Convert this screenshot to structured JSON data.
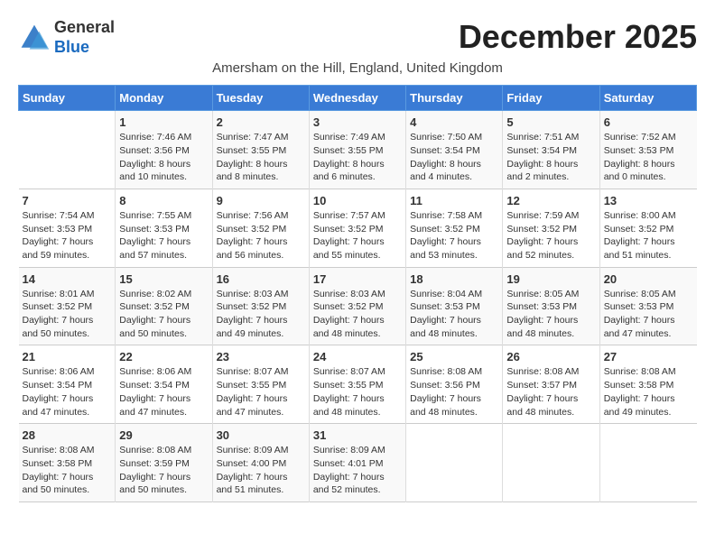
{
  "header": {
    "logo_line1": "General",
    "logo_line2": "Blue",
    "title": "December 2025",
    "subtitle": "Amersham on the Hill, England, United Kingdom"
  },
  "columns": [
    "Sunday",
    "Monday",
    "Tuesday",
    "Wednesday",
    "Thursday",
    "Friday",
    "Saturday"
  ],
  "weeks": [
    [
      {
        "num": "",
        "info": ""
      },
      {
        "num": "1",
        "info": "Sunrise: 7:46 AM\nSunset: 3:56 PM\nDaylight: 8 hours\nand 10 minutes."
      },
      {
        "num": "2",
        "info": "Sunrise: 7:47 AM\nSunset: 3:55 PM\nDaylight: 8 hours\nand 8 minutes."
      },
      {
        "num": "3",
        "info": "Sunrise: 7:49 AM\nSunset: 3:55 PM\nDaylight: 8 hours\nand 6 minutes."
      },
      {
        "num": "4",
        "info": "Sunrise: 7:50 AM\nSunset: 3:54 PM\nDaylight: 8 hours\nand 4 minutes."
      },
      {
        "num": "5",
        "info": "Sunrise: 7:51 AM\nSunset: 3:54 PM\nDaylight: 8 hours\nand 2 minutes."
      },
      {
        "num": "6",
        "info": "Sunrise: 7:52 AM\nSunset: 3:53 PM\nDaylight: 8 hours\nand 0 minutes."
      }
    ],
    [
      {
        "num": "7",
        "info": "Sunrise: 7:54 AM\nSunset: 3:53 PM\nDaylight: 7 hours\nand 59 minutes."
      },
      {
        "num": "8",
        "info": "Sunrise: 7:55 AM\nSunset: 3:53 PM\nDaylight: 7 hours\nand 57 minutes."
      },
      {
        "num": "9",
        "info": "Sunrise: 7:56 AM\nSunset: 3:52 PM\nDaylight: 7 hours\nand 56 minutes."
      },
      {
        "num": "10",
        "info": "Sunrise: 7:57 AM\nSunset: 3:52 PM\nDaylight: 7 hours\nand 55 minutes."
      },
      {
        "num": "11",
        "info": "Sunrise: 7:58 AM\nSunset: 3:52 PM\nDaylight: 7 hours\nand 53 minutes."
      },
      {
        "num": "12",
        "info": "Sunrise: 7:59 AM\nSunset: 3:52 PM\nDaylight: 7 hours\nand 52 minutes."
      },
      {
        "num": "13",
        "info": "Sunrise: 8:00 AM\nSunset: 3:52 PM\nDaylight: 7 hours\nand 51 minutes."
      }
    ],
    [
      {
        "num": "14",
        "info": "Sunrise: 8:01 AM\nSunset: 3:52 PM\nDaylight: 7 hours\nand 50 minutes."
      },
      {
        "num": "15",
        "info": "Sunrise: 8:02 AM\nSunset: 3:52 PM\nDaylight: 7 hours\nand 50 minutes."
      },
      {
        "num": "16",
        "info": "Sunrise: 8:03 AM\nSunset: 3:52 PM\nDaylight: 7 hours\nand 49 minutes."
      },
      {
        "num": "17",
        "info": "Sunrise: 8:03 AM\nSunset: 3:52 PM\nDaylight: 7 hours\nand 48 minutes."
      },
      {
        "num": "18",
        "info": "Sunrise: 8:04 AM\nSunset: 3:53 PM\nDaylight: 7 hours\nand 48 minutes."
      },
      {
        "num": "19",
        "info": "Sunrise: 8:05 AM\nSunset: 3:53 PM\nDaylight: 7 hours\nand 48 minutes."
      },
      {
        "num": "20",
        "info": "Sunrise: 8:05 AM\nSunset: 3:53 PM\nDaylight: 7 hours\nand 47 minutes."
      }
    ],
    [
      {
        "num": "21",
        "info": "Sunrise: 8:06 AM\nSunset: 3:54 PM\nDaylight: 7 hours\nand 47 minutes."
      },
      {
        "num": "22",
        "info": "Sunrise: 8:06 AM\nSunset: 3:54 PM\nDaylight: 7 hours\nand 47 minutes."
      },
      {
        "num": "23",
        "info": "Sunrise: 8:07 AM\nSunset: 3:55 PM\nDaylight: 7 hours\nand 47 minutes."
      },
      {
        "num": "24",
        "info": "Sunrise: 8:07 AM\nSunset: 3:55 PM\nDaylight: 7 hours\nand 48 minutes."
      },
      {
        "num": "25",
        "info": "Sunrise: 8:08 AM\nSunset: 3:56 PM\nDaylight: 7 hours\nand 48 minutes."
      },
      {
        "num": "26",
        "info": "Sunrise: 8:08 AM\nSunset: 3:57 PM\nDaylight: 7 hours\nand 48 minutes."
      },
      {
        "num": "27",
        "info": "Sunrise: 8:08 AM\nSunset: 3:58 PM\nDaylight: 7 hours\nand 49 minutes."
      }
    ],
    [
      {
        "num": "28",
        "info": "Sunrise: 8:08 AM\nSunset: 3:58 PM\nDaylight: 7 hours\nand 50 minutes."
      },
      {
        "num": "29",
        "info": "Sunrise: 8:08 AM\nSunset: 3:59 PM\nDaylight: 7 hours\nand 50 minutes."
      },
      {
        "num": "30",
        "info": "Sunrise: 8:09 AM\nSunset: 4:00 PM\nDaylight: 7 hours\nand 51 minutes."
      },
      {
        "num": "31",
        "info": "Sunrise: 8:09 AM\nSunset: 4:01 PM\nDaylight: 7 hours\nand 52 minutes."
      },
      {
        "num": "",
        "info": ""
      },
      {
        "num": "",
        "info": ""
      },
      {
        "num": "",
        "info": ""
      }
    ]
  ]
}
